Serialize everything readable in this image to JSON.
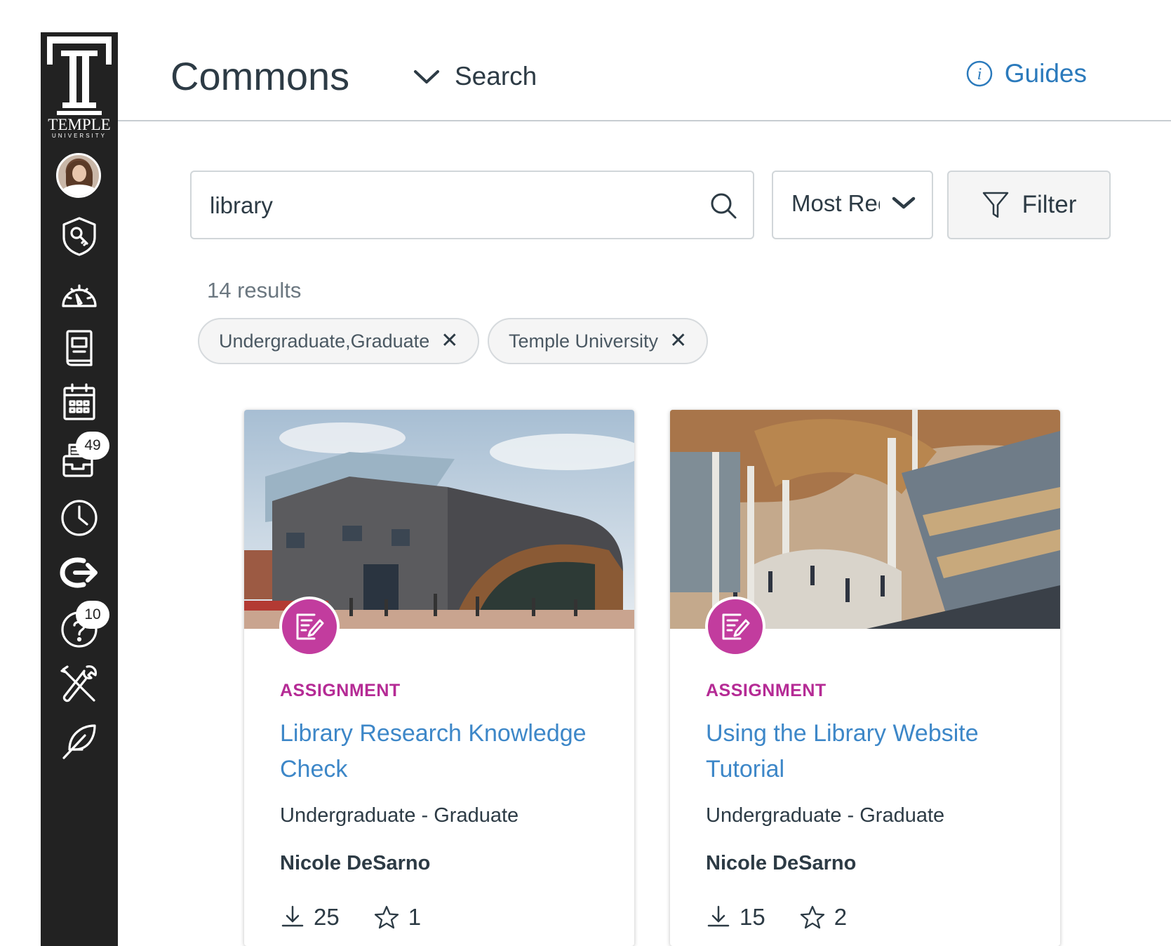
{
  "global_nav": {
    "logo_word": "TEMPLE",
    "logo_sub": "UNIVERSITY",
    "items": [
      {
        "name": "account",
        "icon": "user-avatar"
      },
      {
        "name": "admin",
        "icon": "shield-key-icon"
      },
      {
        "name": "dashboard",
        "icon": "speedometer-icon"
      },
      {
        "name": "courses",
        "icon": "book-icon"
      },
      {
        "name": "calendar",
        "icon": "calendar-icon"
      },
      {
        "name": "inbox",
        "icon": "inbox-icon",
        "badge": "49"
      },
      {
        "name": "history",
        "icon": "clock-icon"
      },
      {
        "name": "commons",
        "icon": "commons-arrow-icon"
      },
      {
        "name": "help",
        "icon": "help-icon",
        "badge": "10"
      },
      {
        "name": "tools",
        "icon": "tools-icon"
      },
      {
        "name": "feather",
        "icon": "feather-icon"
      }
    ]
  },
  "header": {
    "title": "Commons",
    "nav_dropdown_label": "Search",
    "guides_label": "Guides"
  },
  "search": {
    "query": "library",
    "sort_value": "Most Recent",
    "filter_label": "Filter"
  },
  "results": {
    "count_text": "14 results",
    "filters": [
      {
        "label": "Undergraduate,Graduate"
      },
      {
        "label": "Temple University"
      }
    ]
  },
  "cards": [
    {
      "type": "ASSIGNMENT",
      "title": "Library Research Knowledge Check",
      "level": "Undergraduate - Graduate",
      "author": "Nicole DeSarno",
      "downloads": "25",
      "favorites": "1"
    },
    {
      "type": "ASSIGNMENT",
      "title": "Using the Library Website Tutorial",
      "level": "Undergraduate - Graduate",
      "author": "Nicole DeSarno",
      "downloads": "15",
      "favorites": "2"
    }
  ],
  "colors": {
    "nav_bg": "#222222",
    "link": "#3d87c8",
    "assignment": "#b52b95",
    "assignment_icon_bg": "#c23c9e"
  }
}
